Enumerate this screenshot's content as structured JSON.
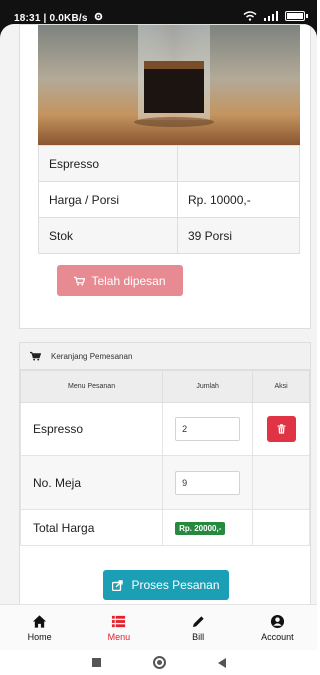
{
  "status_bar": {
    "time_speed": "18:31 | 0.0KB/s",
    "icons": [
      "gear-icon",
      "wifi-icon",
      "signal-icon",
      "battery-icon"
    ]
  },
  "product": {
    "image_icon": "espresso-glass-photo",
    "name": "Espresso",
    "price_label": "Harga / Porsi",
    "price_value": "Rp. 10000,-",
    "stock_label": "Stok",
    "stock_value": "39 Porsi",
    "ordered_button": "Telah dipesan"
  },
  "cart": {
    "title": "Keranjang Pemesanan",
    "columns": [
      "Menu Pesanan",
      "Jumlah",
      "Aksi"
    ],
    "item_name": "Espresso",
    "item_qty": "2",
    "table_label": "No. Meja",
    "table_value": "9",
    "total_label": "Total Harga",
    "total_value": "Rp. 20000,-",
    "process_button": "Proses Pesanan"
  },
  "bottom_nav": [
    {
      "label": "Home",
      "icon": "home-icon"
    },
    {
      "label": "Menu",
      "icon": "menu-list-icon",
      "active": true
    },
    {
      "label": "Bill",
      "icon": "pencil-icon"
    },
    {
      "label": "Account",
      "icon": "user-circle-icon"
    }
  ],
  "colors": {
    "accent_red": "#e3202c",
    "ordered_button": "#e78a92",
    "process_button": "#1b9fb5",
    "delete_button": "#e03344",
    "total_badge": "#27883f"
  }
}
